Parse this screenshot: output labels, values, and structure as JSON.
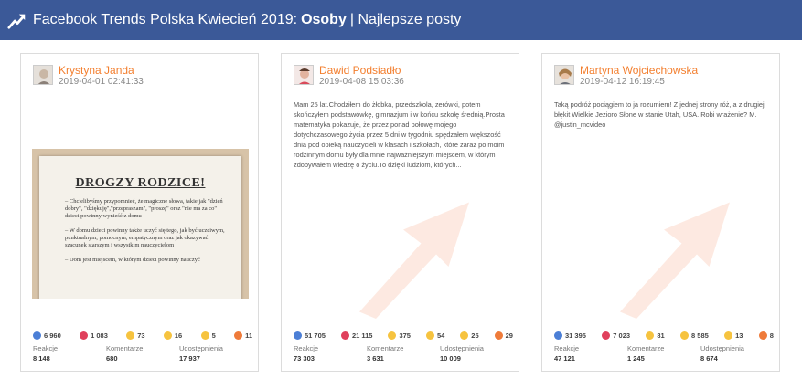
{
  "header": {
    "title_prefix": "Facebook Trends Polska Kwiecień 2019:",
    "title_strong": "Osoby",
    "title_suffix": "| Najlepsze posty"
  },
  "labels": {
    "reactions": "Reakcje",
    "comments": "Komentarze",
    "shares": "Udostępnienia"
  },
  "posts": [
    {
      "author": "Krystyna Janda",
      "date": "2019-04-01 02:41:33",
      "text": "",
      "image": {
        "title": "DROGZY RODZICE!",
        "lines": [
          "– Chcielibyśmy przypomnieć, że magiczne słowa, takie jak \"dzień dobry\", \"dziękuję\",\"przepraszam\", \"proszę\" oraz \"nie ma za co\" dzieci powinny wynieść z domu",
          "– W domu dzieci powinny także uczyć się tego, jak być uczciwym, punktualnym, pomocnym, empatycznym oraz jak okazywać szacunek starszym i wszystkim nauczycielom",
          "– Dom jest miejscem, w którym dzieci powinny nauczyć"
        ]
      },
      "reactions": {
        "like": "6 960",
        "love": "1 083",
        "haha": "73",
        "wow": "16",
        "sad": "5",
        "angry": "11"
      },
      "stats": {
        "reactions": "8 148",
        "comments": "680",
        "shares": "17 937"
      }
    },
    {
      "author": "Dawid Podsiadło",
      "date": "2019-04-08 15:03:36",
      "text": "Mam 25 lat.Chodziłem do żłobka, przedszkola, zerówki, potem skończyłem podstawówkę, gimnazjum i w końcu szkołę średnią.Prosta matematyka pokazuje, że przez ponad połowę mojego dotychczasowego życia przez 5 dni w tygodniu spędzałem większość dnia pod opieką nauczycieli w klasach i szkołach, które zaraz po moim rodzinnym domu były dla mnie najważniejszym miejscem, w którym zdobywałem wiedzę o życiu.To dzięki ludziom, których...",
      "reactions": {
        "like": "51 705",
        "love": "21 115",
        "haha": "375",
        "wow": "54",
        "sad": "25",
        "angry": "29"
      },
      "stats": {
        "reactions": "73 303",
        "comments": "3 631",
        "shares": "10 009"
      }
    },
    {
      "author": "Martyna Wojciechowska",
      "date": "2019-04-12 16:19:45",
      "text": "Taką podróż pociągiem to ja rozumiem! Z jednej strony róż, a z drugiej błękit Wielkie Jezioro Słone w stanie Utah, USA. Robi wrażenie? M. @justin_mcvideo",
      "reactions": {
        "like": "31 395",
        "love": "7 023",
        "haha": "81",
        "wow": "8 585",
        "sad": "13",
        "angry": "8"
      },
      "stats": {
        "reactions": "47 121",
        "comments": "1 245",
        "shares": "8 674"
      }
    }
  ],
  "colors": {
    "header_bg": "#3b5998",
    "author": "#f37f2f",
    "watermark": "#f7a07a"
  }
}
